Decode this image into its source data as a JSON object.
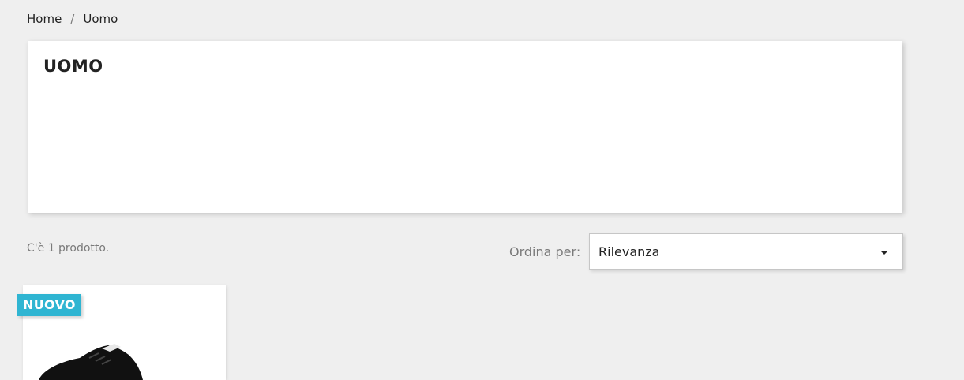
{
  "breadcrumb": {
    "items": [
      {
        "label": "Home"
      },
      {
        "label": "Uomo"
      }
    ],
    "separator": "/"
  },
  "category": {
    "title": "UOMO"
  },
  "listing": {
    "product_count_text": "C'è 1 prodotto.",
    "sort_label": "Ordina per:",
    "sort_selected": "Rilevanza"
  },
  "products": [
    {
      "badge": "NUOVO",
      "image_icon": "sneaker-image"
    }
  ],
  "colors": {
    "accent": "#2fb5d2",
    "background": "#efefef",
    "text": "#232323",
    "muted": "#7a7a7a"
  }
}
